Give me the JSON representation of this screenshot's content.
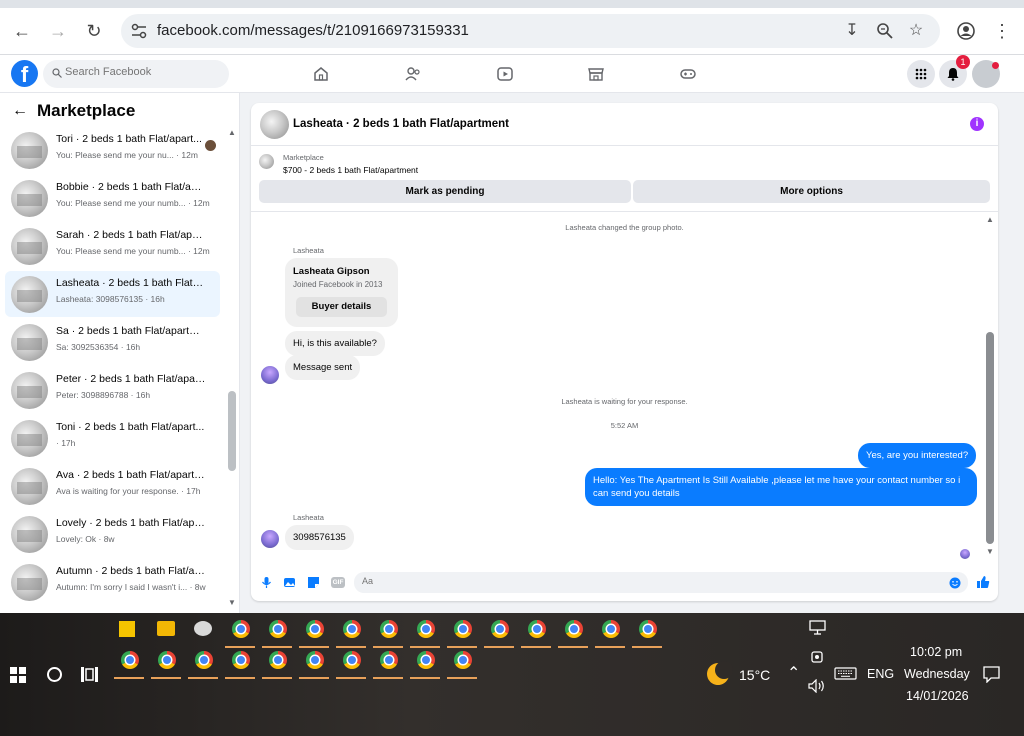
{
  "browser": {
    "url": "facebook.com/messages/t/2109166973159331"
  },
  "fb": {
    "search_placeholder": "Search Facebook",
    "notification_count": "1",
    "logo_letter": "f"
  },
  "marketplace": {
    "title": "Marketplace",
    "conversations": [
      {
        "name": "Tori · 2 beds 1 bath Flat/apart...",
        "snippet": "You: Please send me your nu... · 12m",
        "active": false
      },
      {
        "name": "Bobbie · 2 beds 1 bath Flat/apa...",
        "snippet": "You: Please send me your numb... · 12m",
        "active": false
      },
      {
        "name": "Sarah · 2 beds 1 bath Flat/apart...",
        "snippet": "You: Please send me your numb... · 12m",
        "active": false
      },
      {
        "name": "Lasheata · 2 beds 1 bath Flat/ap...",
        "snippet": "Lasheata: 3098576135 · 16h",
        "active": true
      },
      {
        "name": "Sa · 2 beds 1 bath Flat/apartment",
        "snippet": "Sa: 3092536354 · 16h",
        "active": false
      },
      {
        "name": "Peter · 2 beds 1 bath Flat/apart...",
        "snippet": "Peter: 3098896788 · 16h",
        "active": false
      },
      {
        "name": "Toni · 2 beds 1 bath Flat/apart...",
        "snippet": "· 17h",
        "active": false
      },
      {
        "name": "Ava · 2 beds 1 bath Flat/apartm...",
        "snippet": "Ava is waiting for your response. · 17h",
        "active": false
      },
      {
        "name": "Lovely · 2 beds 1 bath Flat/apar...",
        "snippet": "Lovely: Ok · 8w",
        "active": false
      },
      {
        "name": "Autumn · 2 beds 1 bath Flat/ap...",
        "snippet": "Autumn: I'm sorry I said I wasn't i... · 8w",
        "active": false
      }
    ]
  },
  "chat": {
    "title": "Lasheata · 2 beds 1 bath Flat/apartment",
    "listing_label": "Marketplace",
    "listing_price": "$700 - 2 beds 1 bath Flat/apartment",
    "mark_pending": "Mark as pending",
    "more_options": "More options",
    "sys_group_photo": "Lasheata changed the group photo.",
    "sender1": "Lasheata",
    "card_name": "Lasheata Gipson",
    "card_joined": "Joined Facebook in 2013",
    "card_button": "Buyer details",
    "msg_available": "Hi, is this available?",
    "msg_sent": "Message sent",
    "sys_waiting": "Lasheata is waiting for your response.",
    "time": "5:52 AM",
    "out1": "Yes, are you interested?",
    "out2": "Hello: Yes The Apartment Is Still Available ,please let me have your contact number so i can send you details",
    "sender2": "Lasheata",
    "msg_number": "3098576135",
    "composer_placeholder": "Aa"
  },
  "taskbar": {
    "weather": "15°C",
    "language": "ENG",
    "time": "10:02 pm",
    "day": "Wednesday",
    "date": "14/01/2026"
  },
  "colors": {
    "accent": "#0a7cff",
    "fb_blue": "#1877f2",
    "active_row": "#ebf5ff"
  }
}
